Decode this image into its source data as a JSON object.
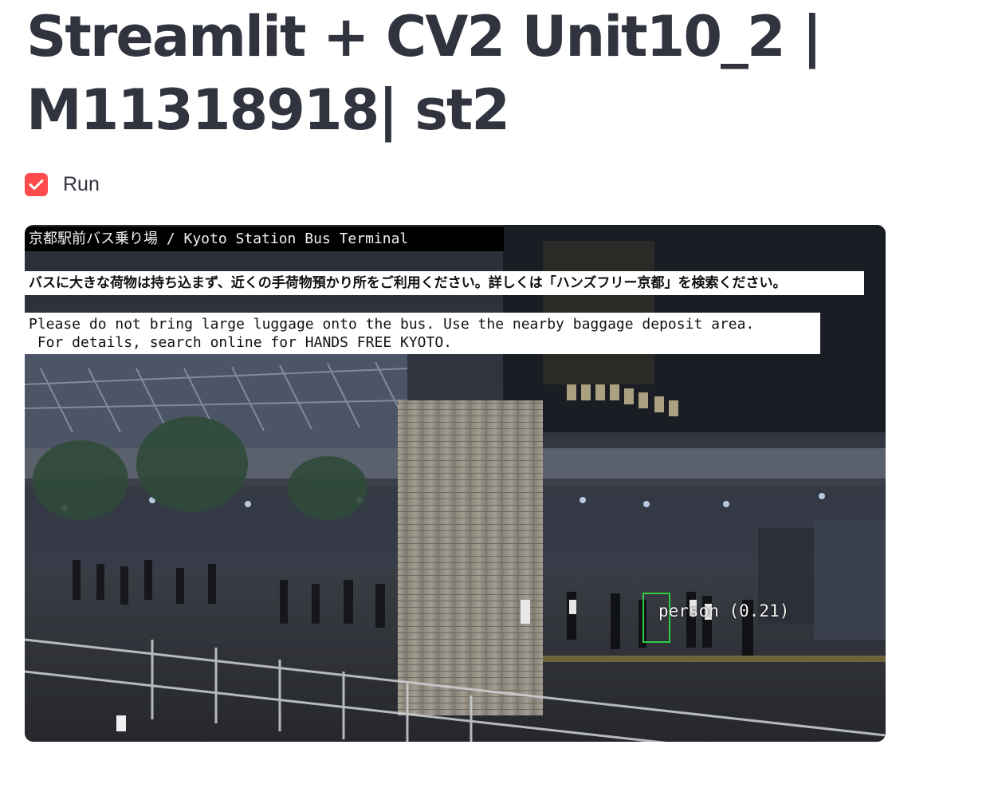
{
  "title": {
    "line1": "Streamlit + CV2 Unit10_2 |",
    "line2": "M11318918| st2"
  },
  "run_checkbox": {
    "label": "Run",
    "checked": true,
    "accent_color": "#ff4b4b"
  },
  "video": {
    "caption": "京都駅前バス乗り場 / Kyoto Station Bus Terminal",
    "notice_jp": "バスに大きな荷物は持ち込まず、近くの手荷物預かり所をご利用ください。詳しくは「ハンズフリー京都」を検索ください。",
    "notice_en_line1": "Please do not bring large luggage onto the bus. Use the nearby baggage deposit area.",
    "notice_en_line2": " For details, search online for HANDS FREE KYOTO.",
    "detection": {
      "label": "person (0.21)",
      "box_color": "#2ecc40"
    }
  }
}
